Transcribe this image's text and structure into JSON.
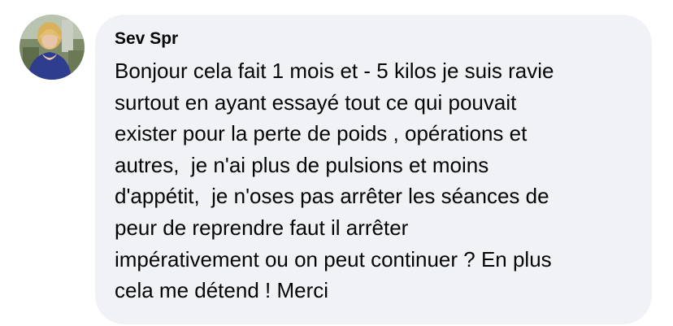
{
  "comment": {
    "author": "Sev Spr",
    "avatar_icon": "user-profile-photo",
    "lines": [
      "Bonjour cela fait 1 mois et - 5 kilos je suis ravie",
      "surtout en ayant essayé tout ce qui pouvait",
      "exister pour la perte de poids , opérations et",
      "autres,  je n'ai plus de pulsions et moins",
      "d'appétit,  je n'oses pas arrêter les séances de",
      "peur de reprendre faut il arrêter",
      "impérativement ou on peut continuer ? En plus",
      "cela me détend ! Merci"
    ]
  },
  "colors": {
    "bubble_background": "#f0f2f5",
    "text": "#050505",
    "avatar_dress": "#2f3d8f",
    "avatar_hair": "#d9b15c"
  }
}
